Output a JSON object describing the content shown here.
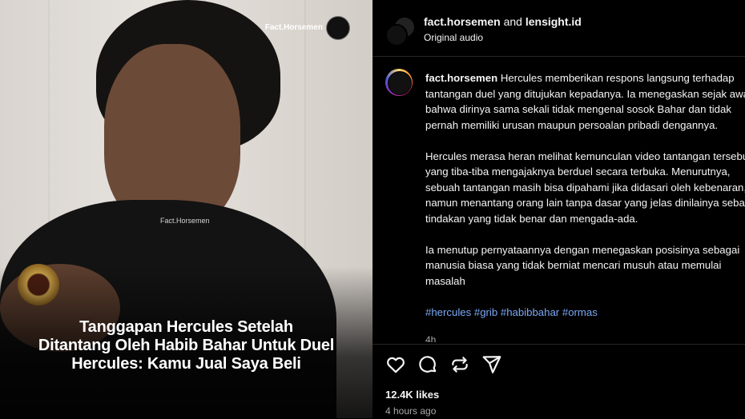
{
  "media": {
    "watermark_top": "Fact.Horsemen",
    "watermark_mid": "Fact.Horsemen",
    "caption_lines": [
      "Tanggapan Hercules Setelah",
      "Ditantang Oleh Habib Bahar Untuk Duel",
      "Hercules: Kamu Jual Saya Beli"
    ]
  },
  "header": {
    "user1": "fact.horsemen",
    "and_text": "and",
    "user2": "lensight.id",
    "audio": "Original audio"
  },
  "post": {
    "username": "fact.horsemen",
    "paragraph1": "Hercules memberikan respons langsung terhadap tantangan duel yang ditujukan kepadanya. Ia menegaskan sejak awal bahwa dirinya sama sekali tidak mengenal sosok Bahar dan tidak pernah memiliki urusan maupun persoalan pribadi dengannya.",
    "paragraph2": "Hercules merasa heran melihat kemunculan video tantangan tersebut yang tiba-tiba mengajaknya berduel secara terbuka. Menurutnya, sebuah tantangan masih bisa dipahami jika didasari oleh kebenaran, namun menantang orang lain tanpa dasar yang jelas dinilainya sebagai tindakan yang tidak benar dan mengada-ada.",
    "paragraph3": "Ia menutup pernyataannya dengan menegaskan posisinya sebagai manusia biasa yang tidak berniat mencari musuh atau memulai masalah",
    "hashtags": [
      "#hercules",
      "#grib",
      "#habibbahar",
      "#ormas"
    ],
    "time_small": "4h"
  },
  "actions": {
    "icons": [
      "heart-icon",
      "comment-icon",
      "repost-icon",
      "share-icon"
    ],
    "likes": "12.4K likes",
    "posted": "4 hours ago"
  }
}
